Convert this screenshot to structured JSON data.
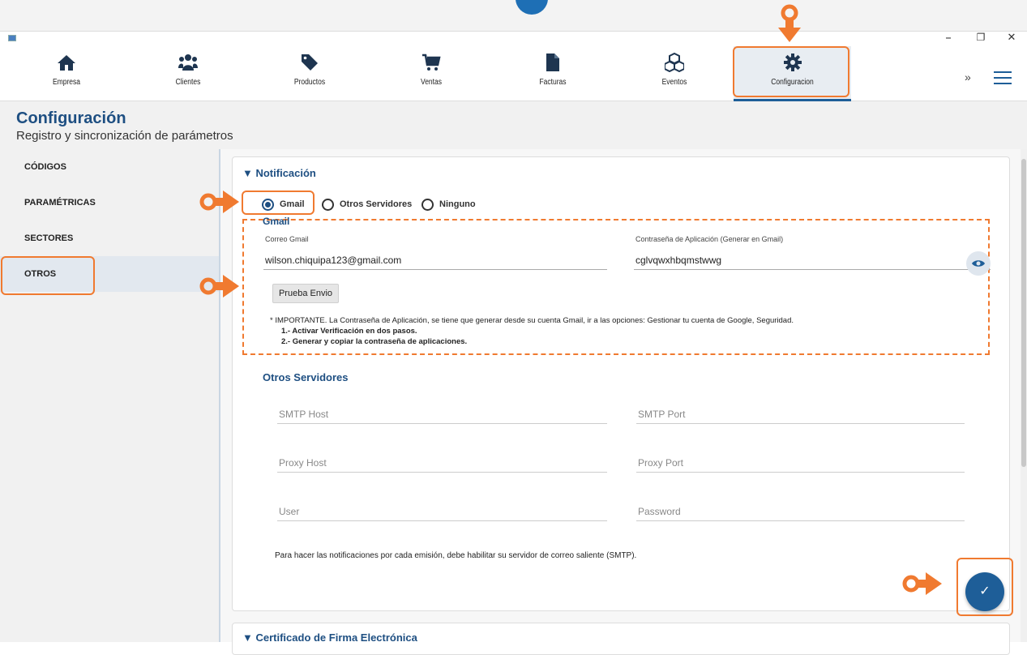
{
  "nav": {
    "items": [
      {
        "label": "Empresa",
        "icon": "home-icon"
      },
      {
        "label": "Clientes",
        "icon": "users-icon"
      },
      {
        "label": "Productos",
        "icon": "tags-icon"
      },
      {
        "label": "Ventas",
        "icon": "cart-icon"
      },
      {
        "label": "Facturas",
        "icon": "file-icon"
      },
      {
        "label": "Eventos",
        "icon": "cubes-icon"
      },
      {
        "label": "Configuracion",
        "icon": "gear-icon"
      }
    ],
    "active": "Configuracion",
    "more": "»"
  },
  "window_controls": {
    "minimize": "–",
    "restore": "❐",
    "close": "✕"
  },
  "page": {
    "title": "Configuración",
    "subtitle": "Registro y sincronización de parámetros"
  },
  "sidebar": {
    "items": [
      "CÓDIGOS",
      "PARAMÉTRICAS",
      "SECTORES",
      "OTROS"
    ],
    "active": "OTROS"
  },
  "notification": {
    "header": "▼ Notificación",
    "options": [
      "Gmail",
      "Otros Servidores",
      "Ninguno"
    ],
    "selected": "Gmail",
    "gmail": {
      "title": "Gmail",
      "email_label": "Correo Gmail",
      "email_value": "wilson.chiquipa123@gmail.com",
      "password_label": "Contraseña de Aplicación (Generar en Gmail)",
      "password_value": "cglvqwxhbqmstwwg",
      "test_button": "Prueba Envio",
      "note": "* IMPORTANTE. La Contraseña de Aplicación, se tiene que generar desde su cuenta Gmail, ir a las opciones: Gestionar tu cuenta de Google, Seguridad.",
      "step1": "1.- Activar Verificación en dos pasos.",
      "step2": "2.- Generar y copiar la contraseña de aplicaciones."
    },
    "other_servers": {
      "title": "Otros Servidores",
      "smtp_host": "SMTP Host",
      "smtp_port": "SMTP Port",
      "proxy_host": "Proxy Host",
      "proxy_port": "Proxy Port",
      "user": "User",
      "password": "Password",
      "note": "Para hacer las notificaciones por cada emisión, debe habilitar su servidor de correo saliente (SMTP)."
    },
    "save_icon": "check-icon"
  },
  "certificate": {
    "header": "▼ Certificado de Firma Electrónica"
  },
  "colors": {
    "accent": "#1e5e98",
    "highlight": "#f07a30",
    "title": "#1e4f82"
  }
}
